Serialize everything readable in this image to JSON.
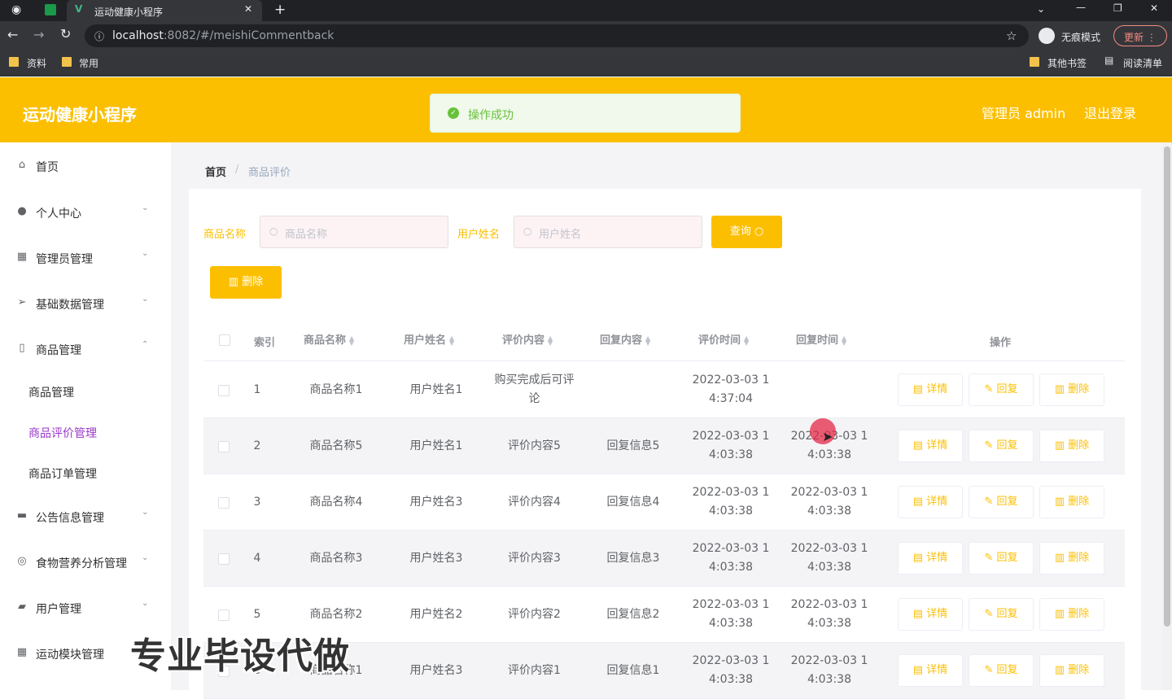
{
  "browser": {
    "tab_title": "运动健康小程序",
    "url_host": "localhost",
    "url_rest": ":8082/#/meishiCommentback",
    "incognito_label": "无痕模式",
    "update_label": "更新",
    "bookmarks": [
      "资料",
      "常用"
    ],
    "bookmarks_right": [
      "其他书签",
      "阅读清单"
    ]
  },
  "header": {
    "title": "运动健康小程序",
    "user_label": "管理员 admin",
    "logout_label": "退出登录",
    "toast": "操作成功"
  },
  "sidebar": {
    "items": [
      {
        "label": "首页",
        "icon": "home-icon"
      },
      {
        "label": "个人中心",
        "icon": "user-icon"
      },
      {
        "label": "管理员管理",
        "icon": "grid-icon"
      },
      {
        "label": "基础数据管理",
        "icon": "send-icon"
      },
      {
        "label": "商品管理",
        "icon": "mobile-icon"
      },
      {
        "label": "公告信息管理",
        "icon": "briefcase-icon"
      },
      {
        "label": "食物营养分析管理",
        "icon": "compass-icon"
      },
      {
        "label": "用户管理",
        "icon": "chat-icon"
      },
      {
        "label": "运动模块管理",
        "icon": "menu-icon"
      }
    ],
    "subitems": [
      "商品管理",
      "商品评价管理",
      "商品订单管理"
    ],
    "active_color": "#9b37c9"
  },
  "breadcrumb": {
    "home": "首页",
    "current": "商品评价"
  },
  "filters": {
    "product_label": "商品名称",
    "product_placeholder": "商品名称",
    "user_label": "用户姓名",
    "user_placeholder": "用户姓名",
    "search_button": "查询",
    "delete_button": "删除"
  },
  "table": {
    "headers": [
      "索引",
      "商品名称",
      "用户姓名",
      "评价内容",
      "回复内容",
      "评价时间",
      "回复时间",
      "操作"
    ],
    "rows": [
      {
        "index": "1",
        "product": "商品名称1",
        "user": "用户姓名1",
        "comment": "购买完成后可评论",
        "reply": "",
        "comment_time_1": "2022-03-03 1",
        "comment_time_2": "4:37:04",
        "reply_time_1": "",
        "reply_time_2": ""
      },
      {
        "index": "2",
        "product": "商品名称5",
        "user": "用户姓名1",
        "comment": "评价内容5",
        "reply": "回复信息5",
        "comment_time_1": "2022-03-03 1",
        "comment_time_2": "4:03:38",
        "reply_time_1": "2022-03-03 1",
        "reply_time_2": "4:03:38"
      },
      {
        "index": "3",
        "product": "商品名称4",
        "user": "用户姓名3",
        "comment": "评价内容4",
        "reply": "回复信息4",
        "comment_time_1": "2022-03-03 1",
        "comment_time_2": "4:03:38",
        "reply_time_1": "2022-03-03 1",
        "reply_time_2": "4:03:38"
      },
      {
        "index": "4",
        "product": "商品名称3",
        "user": "用户姓名3",
        "comment": "评价内容3",
        "reply": "回复信息3",
        "comment_time_1": "2022-03-03 1",
        "comment_time_2": "4:03:38",
        "reply_time_1": "2022-03-03 1",
        "reply_time_2": "4:03:38"
      },
      {
        "index": "5",
        "product": "商品名称2",
        "user": "用户姓名2",
        "comment": "评价内容2",
        "reply": "回复信息2",
        "comment_time_1": "2022-03-03 1",
        "comment_time_2": "4:03:38",
        "reply_time_1": "2022-03-03 1",
        "reply_time_2": "4:03:38"
      },
      {
        "index": "6",
        "product": "商品名称1",
        "user": "用户姓名3",
        "comment": "评价内容1",
        "reply": "回复信息1",
        "comment_time_1": "2022-03-03 1",
        "comment_time_2": "4:03:38",
        "reply_time_1": "2022-03-03 1",
        "reply_time_2": "4:03:38"
      }
    ],
    "actions": {
      "detail": "详情",
      "reply": "回复",
      "delete": "删除"
    }
  },
  "watermark": "专业毕设代做",
  "colors": {
    "brand": "#fcbf00",
    "toast_bg": "#f0f9eb",
    "toast_text": "#67c23a"
  }
}
